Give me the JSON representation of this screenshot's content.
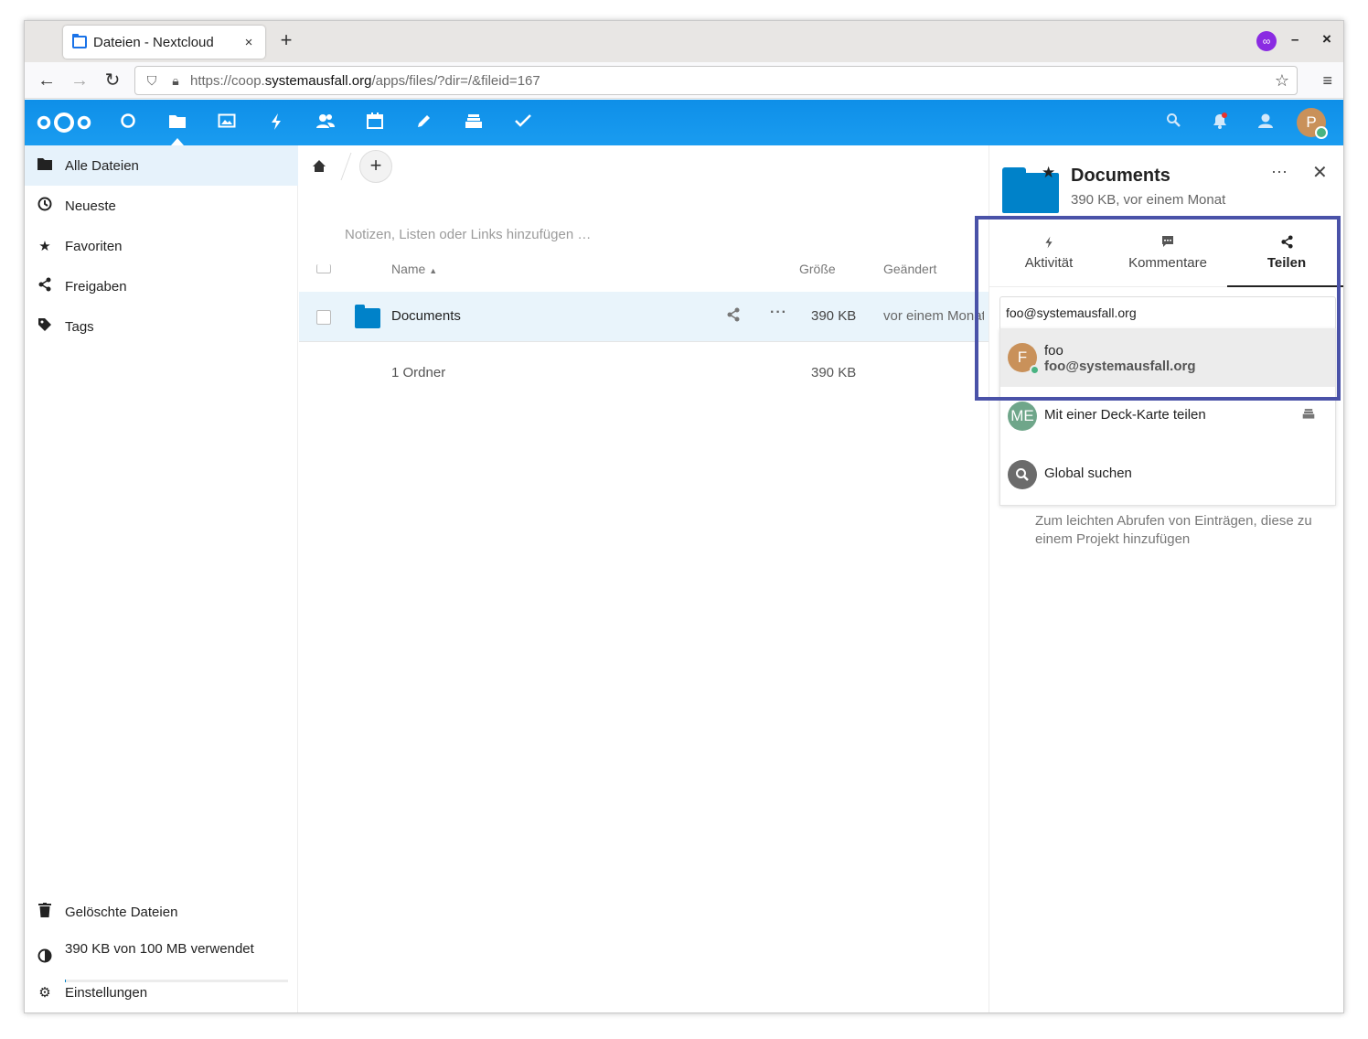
{
  "browser": {
    "tab_title": "Dateien - Nextcloud",
    "tab_close": "×",
    "new_tab": "+",
    "url_plain_prefix": "https://coop.",
    "url_domain": "systemausfall.org",
    "url_path": "/apps/files/?dir=/&fileid=167",
    "minimize": "–",
    "close": "×"
  },
  "nc_header": {
    "apps": [
      "dashboard-icon",
      "files-icon",
      "photos-icon",
      "activity-icon",
      "contacts-icon",
      "calendar-icon",
      "notes-icon",
      "deck-icon",
      "tasks-icon"
    ],
    "active_app": "files-icon",
    "avatar_initial": "P",
    "accent_color": "#0082c9"
  },
  "leftnav": {
    "items": [
      {
        "label": "Alle Dateien",
        "icon": "folder-icon"
      },
      {
        "label": "Neueste",
        "icon": "clock-icon"
      },
      {
        "label": "Favoriten",
        "icon": "star-icon"
      },
      {
        "label": "Freigaben",
        "icon": "share-icon"
      },
      {
        "label": "Tags",
        "icon": "tag-icon"
      }
    ],
    "deleted": "Gelöschte Dateien",
    "quota": "390 KB von 100 MB verwendet",
    "quota_fraction": 0.004,
    "settings": "Einstellungen"
  },
  "files": {
    "rich_workspace_placeholder": "Notizen, Listen oder Links hinzufügen …",
    "columns": {
      "name": "Name",
      "size": "Größe",
      "modified": "Geändert"
    },
    "rows": [
      {
        "name": "Documents",
        "size": "390 KB",
        "modified": "vor einem Monat"
      }
    ],
    "summary": {
      "label": "1 Ordner",
      "size": "390 KB"
    }
  },
  "sidebar": {
    "title": "Documents",
    "subtitle": "390 KB, vor einem Monat",
    "tabs": [
      {
        "label": "Aktivität",
        "icon": "activity-icon"
      },
      {
        "label": "Kommentare",
        "icon": "comment-icon"
      },
      {
        "label": "Teilen",
        "icon": "share-icon"
      }
    ],
    "active_tab": "Teilen",
    "share_input_value": "foo@systemausfall.org",
    "suggestions": [
      {
        "avatar": "F",
        "title": "foo",
        "subtitle": "foo@systemausfall.org",
        "avatar_color": "#c9915a",
        "status": "online"
      },
      {
        "avatar": "ME",
        "title": "Mit einer Deck-Karte teilen",
        "avatar_color": "#6fa68a",
        "trailing_icon": "deck-icon"
      },
      {
        "avatar": "search-icon",
        "title": "Global suchen",
        "avatar_color": "#6b6b6b"
      }
    ],
    "behind_text": "Zum leichten Abrufen von Einträgen, diese zu einem Projekt hinzufügen"
  }
}
